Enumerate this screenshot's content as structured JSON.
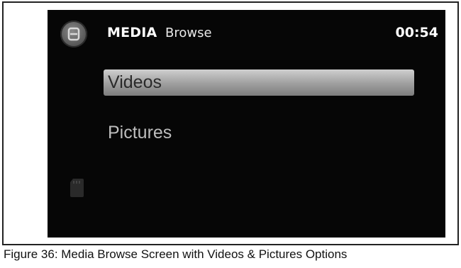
{
  "header": {
    "title": "MEDIA",
    "subtitle": "Browse",
    "clock": "00:54"
  },
  "menu": {
    "items": [
      {
        "label": "Videos",
        "selected": true
      },
      {
        "label": "Pictures",
        "selected": false
      }
    ]
  },
  "icons": {
    "home": "menu-circle-icon",
    "storage": "sd-card-icon"
  },
  "caption": "Figure 36: Media Browse Screen with Videos & Pictures Options",
  "colors": {
    "screen_bg": "#060606",
    "selected_bar": "#a8a8a8",
    "text_light": "#ffffff",
    "text_dim": "#bdbdbd"
  }
}
